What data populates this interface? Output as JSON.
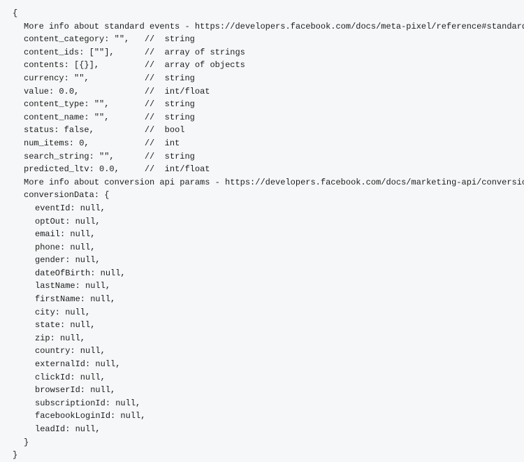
{
  "code": {
    "open": "{",
    "close": "}",
    "comment1": "More info about standard events - https://developers.facebook.com/docs/meta-pixel/reference#standard-events",
    "props": [
      {
        "key": "content_category:",
        "val": "\"\",",
        "pad": 4,
        "comment": "//  string"
      },
      {
        "key": "content_ids:",
        "val": "[\"\"],",
        "pad": 6,
        "comment": "//  array of strings"
      },
      {
        "key": "contents:",
        "val": "[{}],",
        "pad": 8,
        "comment": "//  array of objects"
      },
      {
        "key": "currency:",
        "val": "\"\",",
        "pad": 10,
        "comment": "//  string"
      },
      {
        "key": "value:",
        "val": "0.0,",
        "pad": 12,
        "comment": "//  int/float"
      },
      {
        "key": "content_type:",
        "val": "\"\",",
        "pad": 6,
        "comment": "//  string"
      },
      {
        "key": "content_name:",
        "val": "\"\",",
        "pad": 6,
        "comment": "//  string"
      },
      {
        "key": "status:",
        "val": "false,",
        "pad": 9,
        "comment": "//  bool"
      },
      {
        "key": "num_items:",
        "val": "0,",
        "pad": 11,
        "comment": "//  int"
      },
      {
        "key": "search_string:",
        "val": "\"\",",
        "pad": 5,
        "comment": "//  string"
      },
      {
        "key": "predicted_ltv:",
        "val": "0.0,",
        "pad": 4,
        "comment": "//  int/float"
      }
    ],
    "comment2": "More info about conversion api params - https://developers.facebook.com/docs/marketing-api/conversions-api/parameters/customer-information-parameters",
    "conversion_open": "conversionData: {",
    "conversion_fields": [
      "eventId: null,",
      "optOut: null,",
      "email: null,",
      "phone: null,",
      "gender: null,",
      "dateOfBirth: null,",
      "lastName: null,",
      "firstName: null,",
      "city: null,",
      "state: null,",
      "zip: null,",
      "country: null,",
      "externalId: null,",
      "clickId: null,",
      "browserId: null,",
      "subscriptionId: null,",
      "facebookLoginId: null,",
      "leadId: null,"
    ],
    "conversion_close": "}"
  }
}
